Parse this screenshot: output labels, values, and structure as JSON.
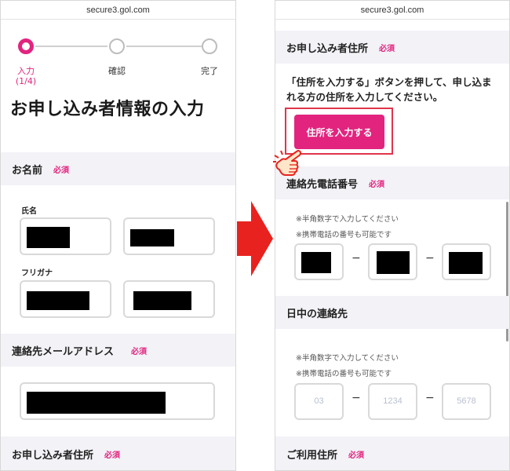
{
  "left": {
    "url": "secure3.gol.com",
    "steps": [
      {
        "label": "入力",
        "sub": "(1/4)"
      },
      {
        "label": "確認"
      },
      {
        "label": "完了"
      }
    ],
    "title": "お申し込み者情報の入力",
    "name_section": {
      "title": "お名前",
      "required": "必須",
      "name_label": "氏名",
      "kana_label": "フリガナ"
    },
    "email_section": {
      "title": "連絡先メールアドレス",
      "required": "必須"
    },
    "address_section": {
      "title": "お申し込み者住所",
      "required": "必須"
    }
  },
  "right": {
    "url": "secure3.gol.com",
    "address_section": {
      "title": "お申し込み者住所",
      "required": "必須"
    },
    "address_desc": "「住所を入力する」ボタンを押して、申し込まれる方の住所を入力してください。",
    "address_button": "住所を入力する",
    "phone_section": {
      "title": "連絡先電話番号",
      "required": "必須",
      "note1": "※半角数字で入力してください",
      "note2": "※携帯電話の番号も可能です"
    },
    "day_section": {
      "title": "日中の連絡先",
      "note1": "※半角数字で入力してください",
      "note2": "※携帯電話の番号も可能です",
      "placeholders": [
        "03",
        "1234",
        "5678"
      ]
    },
    "usage_section": {
      "title": "ご利用住所",
      "required": "必須"
    }
  },
  "colors": {
    "accent": "#e2247f",
    "arrow": "#e8231f",
    "section_bg": "#f3f2f7"
  }
}
